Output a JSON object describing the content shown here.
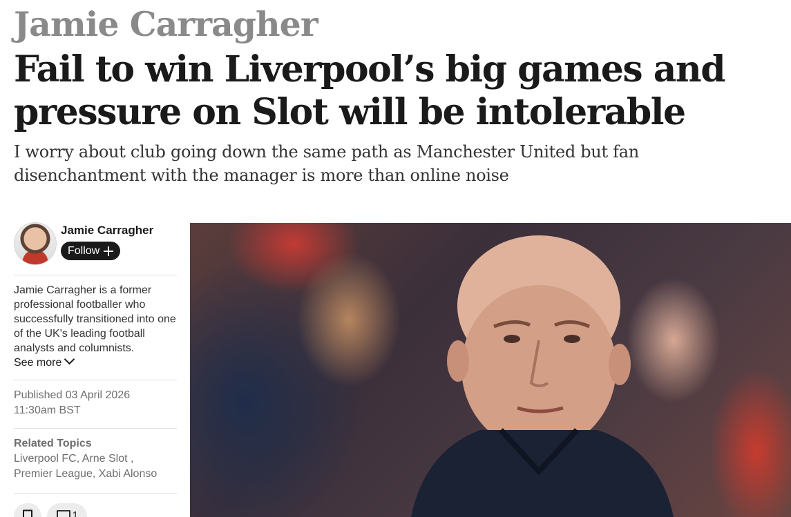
{
  "article": {
    "kicker": "Jamie Carragher",
    "headline": "Fail to win Liverpool’s big games and pressure on Slot will be intolerable",
    "standfirst": "I worry about club going down the same path as Manchester United but fan disenchantment with the manager is more than online noise"
  },
  "author": {
    "name": "Jamie Carragher",
    "follow_label": "Follow",
    "bio": "Jamie Carragher is a former professional footballer who successfully transitioned into one of the UK's leading football analysts and columnists.",
    "see_more_label": "See more"
  },
  "published": {
    "label": "Published 03 April 2026",
    "time": "11:30am BST"
  },
  "related": {
    "title": "Related Topics",
    "topics": [
      "Liverpool FC",
      "Arne Slot",
      "Premier League",
      "Xabi Alonso"
    ]
  },
  "actions": {
    "comment_count": "1"
  },
  "icons": {
    "follow": "plus-icon",
    "see_more": "chevron-down-icon",
    "bookmark": "bookmark-icon",
    "comment": "comment-icon"
  },
  "colors": {
    "kicker": "#8a8a8a",
    "text": "#1a1a1a",
    "meta": "#6e6e6e",
    "button_dark": "#1a1a1a",
    "button_light": "#ececec"
  }
}
